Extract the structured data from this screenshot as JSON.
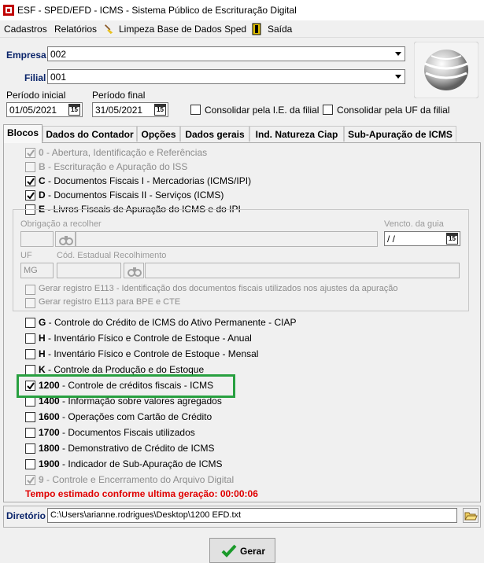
{
  "window": {
    "title": "ESF - SPED/EFD - ICMS - Sistema Público de Escrituração Digital"
  },
  "menu": {
    "cadastros": "Cadastros",
    "relatorios": "Relatórios",
    "limpeza": "Limpeza Base de Dados Sped",
    "saida": "Saída"
  },
  "form": {
    "empresa_label": "Empresa",
    "empresa_value": "002",
    "filial_label": "Filial",
    "filial_value": "001",
    "periodo_inicial_label": "Período inicial",
    "periodo_inicial_value": "01/05/2021",
    "periodo_final_label": "Período final",
    "periodo_final_value": "31/05/2021",
    "consolidar_ie_label": "Consolidar pela I.E. da filial",
    "consolidar_ie_checked": false,
    "consolidar_uf_label": "Consolidar pela UF da filial",
    "consolidar_uf_checked": false
  },
  "tabs": [
    {
      "label": "Blocos",
      "active": true
    },
    {
      "label": "Dados do Contador",
      "active": false
    },
    {
      "label": "Opções",
      "active": false
    },
    {
      "label": "Dados gerais",
      "active": false
    },
    {
      "label": "Ind. Natureza Ciap",
      "active": false
    },
    {
      "label": "Sub-Apuração de ICMS",
      "active": false
    }
  ],
  "blocks_top": [
    {
      "code": "0",
      "text": " - Abertura, Identificação e Referências",
      "checked": true,
      "enabled": false
    },
    {
      "code": "B",
      "text": " - Escrituração e Apuração do ISS",
      "checked": false,
      "enabled": false
    },
    {
      "code": "C",
      "text": " - Documentos Fiscais I - Mercadorias (ICMS/IPI)",
      "checked": true,
      "enabled": true
    },
    {
      "code": "D",
      "text": " - Documentos Fiscais II - Serviços (ICMS)",
      "checked": true,
      "enabled": true
    },
    {
      "code": "E",
      "text": " - Livros Fiscais de Apuração do ICMS e do IPI",
      "checked": false,
      "enabled": true
    }
  ],
  "block_e": {
    "obrigacao_label": "Obrigação a recolher",
    "vencto_label": "Vencto. da guia",
    "vencto_value": " / /",
    "uf_label": "UF",
    "uf_value": "MG",
    "cod_estadual_label": "Cód. Estadual Recolhimento",
    "gerar_e113_label": "Gerar registro E113 - Identificação dos documentos fiscais utilizados nos ajustes da apuração",
    "gerar_e113_bpe_label": "Gerar registro E113 para BPE e CTE"
  },
  "blocks_bottom": [
    {
      "code": "G",
      "text": " - Controle do Crédito de ICMS do Ativo Permanente - CIAP",
      "checked": false,
      "enabled": true
    },
    {
      "code": "H",
      "text": " - Inventário Físico e Controle de Estoque - Anual",
      "checked": false,
      "enabled": true
    },
    {
      "code": "H",
      "text": " - Inventário Físico e Controle de Estoque - Mensal",
      "checked": false,
      "enabled": true
    },
    {
      "code": "K",
      "text": " - Controle da Produção e do Estoque",
      "checked": false,
      "enabled": true
    },
    {
      "code": "1200",
      "text": " - Controle de créditos fiscais - ICMS",
      "checked": true,
      "enabled": true
    },
    {
      "code": "1400",
      "text": " - Informação sobre valores agregados",
      "checked": false,
      "enabled": true
    },
    {
      "code": "1600",
      "text": " - Operações com Cartão de Crédito",
      "checked": false,
      "enabled": true
    },
    {
      "code": "1700",
      "text": " - Documentos Fiscais utilizados",
      "checked": false,
      "enabled": true
    },
    {
      "code": "1800",
      "text": " - Demonstrativo de Crédito de ICMS",
      "checked": false,
      "enabled": true
    },
    {
      "code": "1900",
      "text": " - Indicador de Sub-Apuração de ICMS",
      "checked": false,
      "enabled": true
    },
    {
      "code": "9",
      "text": " - Controle e Encerramento do Arquivo Digital",
      "checked": true,
      "enabled": false
    }
  ],
  "timer_text": "Tempo estimado conforme ultima geração:  00:00:06",
  "diretorio": {
    "label": "Diretório",
    "value": "C:\\Users\\arianne.rodrigues\\Desktop\\1200 EFD.txt"
  },
  "gerar_button": "Gerar",
  "colors": {
    "highlight": "#28a040",
    "timer": "#e00000",
    "label_blue": "#0a246a"
  }
}
